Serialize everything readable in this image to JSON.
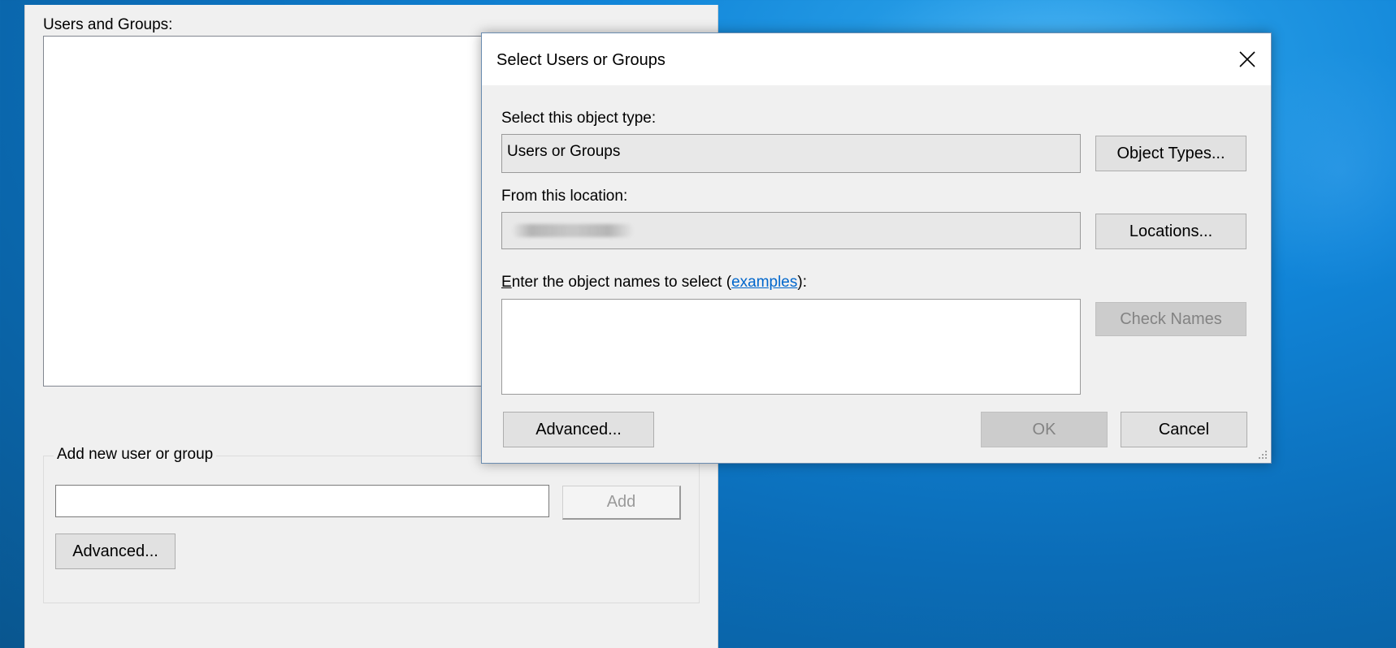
{
  "back_window": {
    "users_groups_label": "Users and Groups:",
    "add_group_title": "Add new user or group",
    "add_button": "Add",
    "advanced_button": "Advanced..."
  },
  "dialog": {
    "title": "Select Users or Groups",
    "object_type_label": "Select this object type:",
    "object_type_value": "Users or Groups",
    "object_types_button": "Object Types...",
    "location_label": "From this location:",
    "location_value": "",
    "locations_button": "Locations...",
    "enter_names_prefix": "nter the object names to select (",
    "enter_names_first_letter": "E",
    "examples_link": "examples",
    "enter_names_suffix": "):",
    "names_value": "",
    "check_names_button": "Check Names",
    "advanced_button": "Advanced...",
    "ok_button": "OK",
    "cancel_button": "Cancel"
  },
  "icons": {
    "close": "close-icon",
    "resize": "resize-grip-icon"
  },
  "colors": {
    "desktop_blue": "#1185d8",
    "link_blue": "#0066cc",
    "dialog_bg": "#f0f0f0",
    "disabled_button": "#cccccc"
  }
}
